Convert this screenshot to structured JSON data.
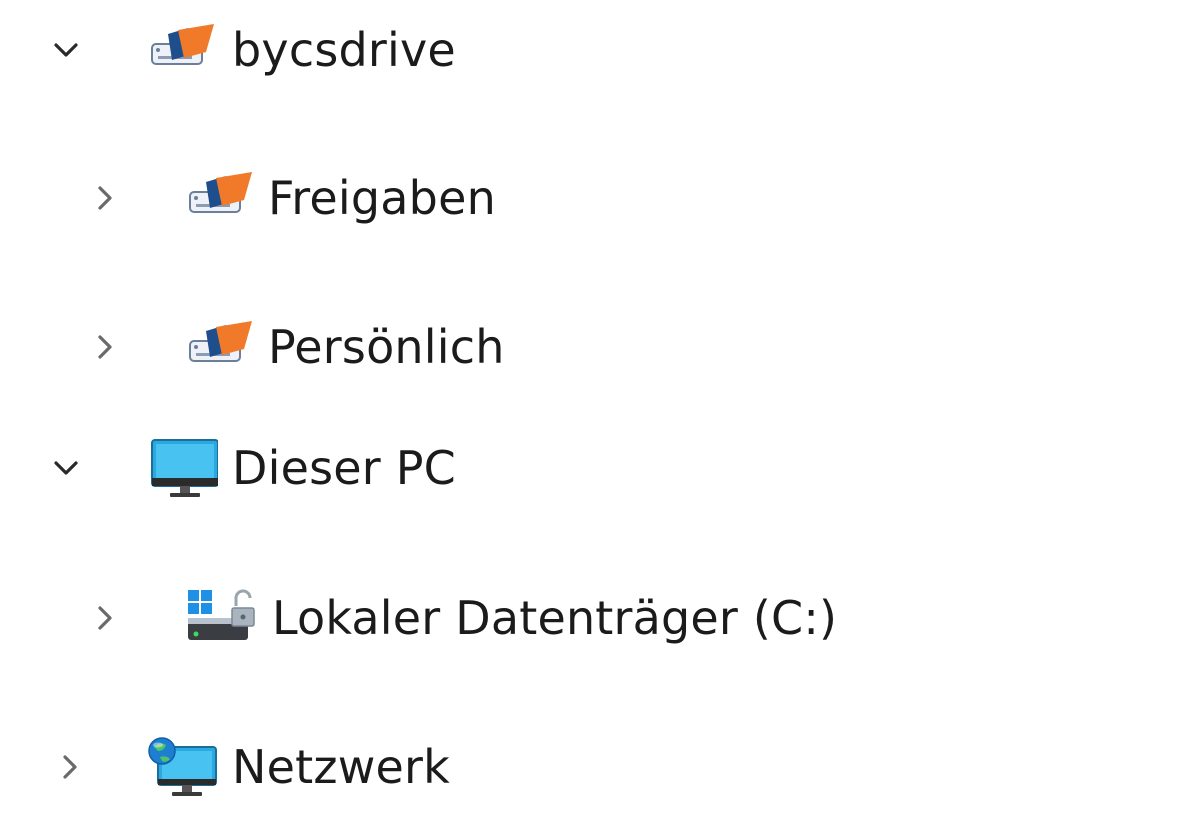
{
  "nav_tree": {
    "items": [
      {
        "label": "bycsdrive",
        "state": "expanded",
        "icon": "network-drive-icon"
      },
      {
        "label": "Freigaben",
        "state": "collapsed",
        "icon": "network-drive-icon"
      },
      {
        "label": "Persönlich",
        "state": "collapsed",
        "icon": "network-drive-icon"
      },
      {
        "label": "Dieser PC",
        "state": "expanded",
        "icon": "monitor-icon"
      },
      {
        "label": "Lokaler Datenträger (C:)",
        "state": "collapsed",
        "icon": "system-drive-icon"
      },
      {
        "label": "Netzwerk",
        "state": "collapsed",
        "icon": "network-globe-icon"
      }
    ]
  },
  "colors": {
    "chevron": "#2a2a2a",
    "text": "#1b1b1b",
    "drive_orange": "#f07a2a",
    "drive_blue": "#1f4e8c",
    "monitor_blue": "#2aa8e0",
    "windows_blue": "#1e90e6"
  }
}
